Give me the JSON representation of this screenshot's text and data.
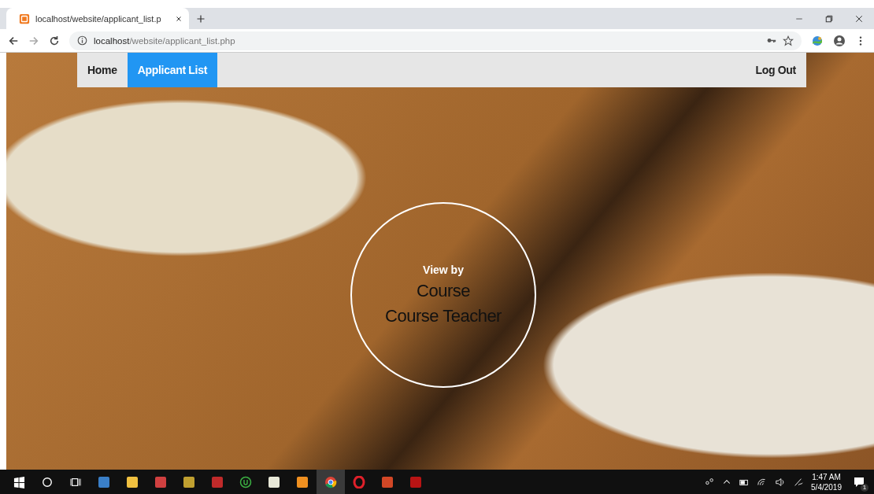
{
  "browser": {
    "tab": {
      "title": "localhost/website/applicant_list.p",
      "selected": true
    },
    "address": {
      "host": "localhost",
      "path": "/website/applicant_list.php"
    }
  },
  "navbar": {
    "items": [
      {
        "label": "Home",
        "selected": false
      },
      {
        "label": "Applicant List",
        "selected": true
      }
    ],
    "logout": "Log Out"
  },
  "view_by": {
    "heading": "View by",
    "options": [
      "Course",
      "Course Teacher"
    ]
  },
  "taskbar": {
    "time": "1:47 AM",
    "date": "5/4/2019",
    "notifications": "1"
  }
}
